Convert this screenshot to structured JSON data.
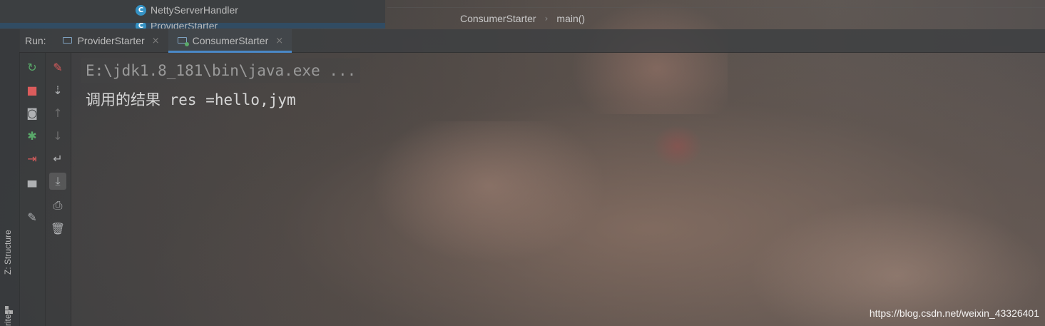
{
  "project_tree": {
    "items": [
      {
        "icon": "class-icon",
        "letter": "C",
        "label": "NettyServerHandler"
      },
      {
        "icon": "class-icon",
        "letter": "C",
        "label": "ProviderStarter"
      }
    ]
  },
  "breadcrumb": {
    "items": [
      "ConsumerStarter",
      "main()"
    ],
    "separator": "›"
  },
  "run_panel": {
    "label": "Run:",
    "tabs": [
      {
        "label": "ProviderStarter",
        "active": false,
        "close": "×"
      },
      {
        "label": "ConsumerStarter",
        "active": true,
        "close": "×"
      }
    ]
  },
  "toolbar_left": [
    {
      "name": "rerun-icon",
      "glyph": "↻",
      "color": "#59a869"
    },
    {
      "name": "stop-icon",
      "glyph": "■",
      "color": "#db5c5c"
    },
    {
      "name": "camera-icon",
      "glyph": "◙",
      "color": "#afb1b3"
    },
    {
      "name": "debug-settings-icon",
      "glyph": "✱",
      "color": "#59a869"
    },
    {
      "name": "exit-icon",
      "glyph": "⇥",
      "color": "#db5c5c"
    },
    {
      "name": "layout-icon",
      "glyph": "▀",
      "color": "#afb1b3"
    },
    {
      "name": "pin-icon",
      "glyph": "✎",
      "color": "#afb1b3"
    }
  ],
  "toolbar_right": [
    {
      "name": "clear-icon",
      "glyph": "✎",
      "color": "#db5c5c"
    },
    {
      "name": "sort-down-icon",
      "glyph": "⇣",
      "color": "#afb1b3"
    },
    {
      "name": "up-arrow-icon",
      "glyph": "↑",
      "color": "#6e6e6e"
    },
    {
      "name": "down-arrow-icon",
      "glyph": "↓",
      "color": "#6e6e6e"
    },
    {
      "name": "soft-wrap-icon",
      "glyph": "↵",
      "color": "#afb1b3"
    },
    {
      "name": "scroll-to-end-icon",
      "glyph": "⤓",
      "color": "#afb1b3",
      "selected": true
    },
    {
      "name": "print-icon",
      "glyph": "⎙",
      "color": "#afb1b3"
    },
    {
      "name": "trash-icon",
      "glyph": "🗑",
      "color": "#afb1b3"
    }
  ],
  "side_labels": {
    "structure": "Z: Structure",
    "favorites": "rites"
  },
  "console": {
    "command": "E:\\jdk1.8_181\\bin\\java.exe ...",
    "output": "调用的结果 res =hello,jym"
  },
  "watermark": "https://blog.csdn.net/weixin_43326401"
}
